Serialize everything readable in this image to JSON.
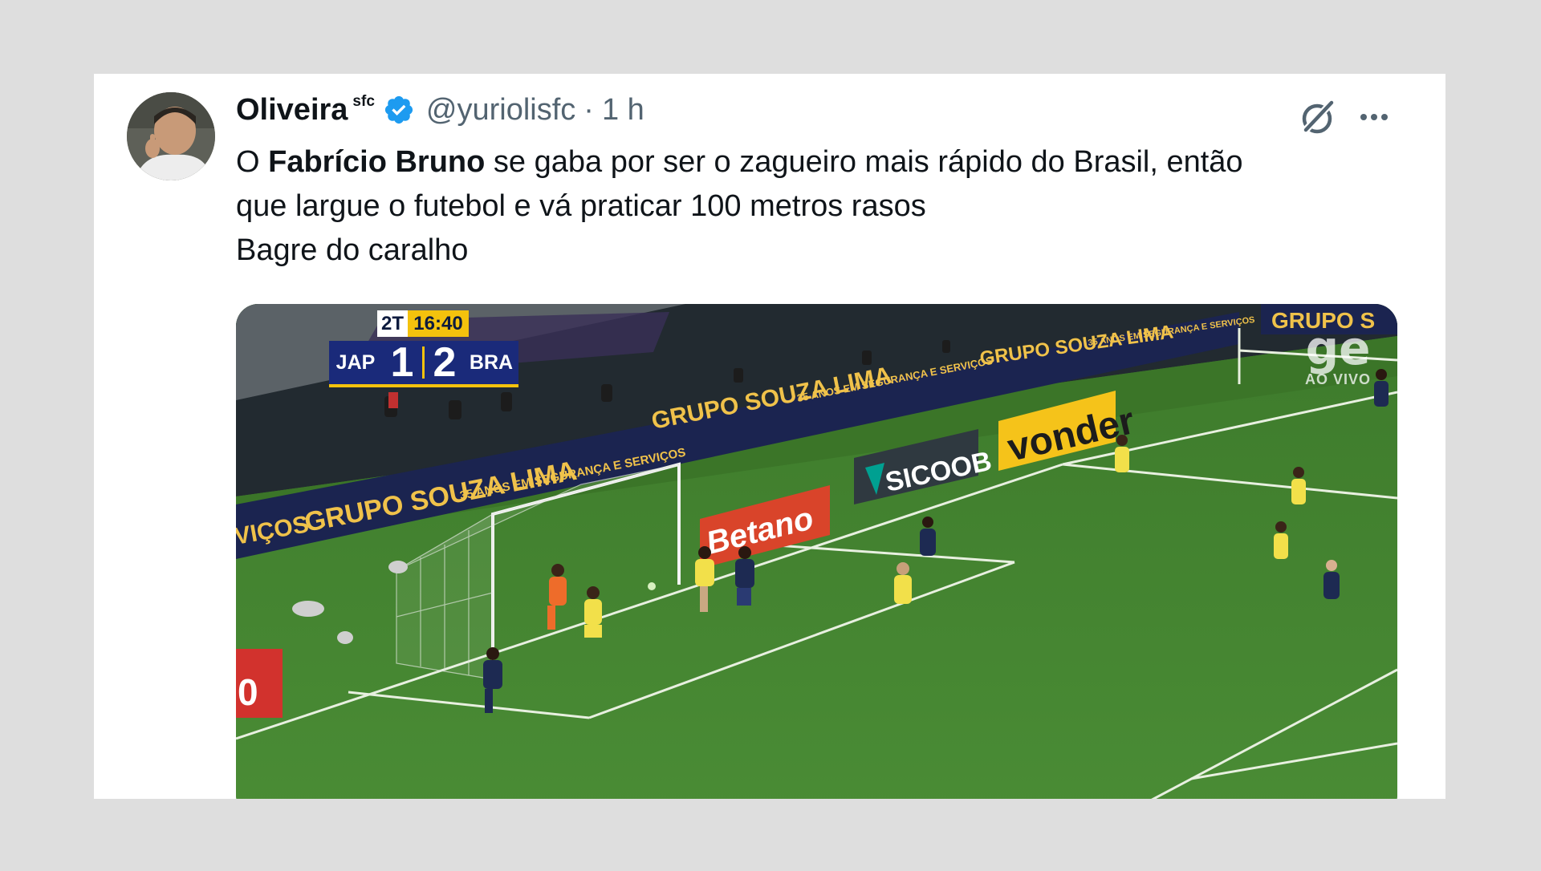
{
  "tweet": {
    "author_name": "Oliveira",
    "author_suffix": "sfc",
    "handle": "@yuriolisfc",
    "separator": "·",
    "time": "1 h",
    "text": {
      "line1_prefix": "O ",
      "line1_bold": "Fabrício Bruno",
      "line1_suffix": " se gaba por ser o zagueiro mais rápido do Brasil, então",
      "line2": "que largue o futebol e vá praticar 100 metros rasos",
      "line3": "Bagre do caralho"
    }
  },
  "media": {
    "scorebug": {
      "period": "2T",
      "clock": "16:40",
      "home_team": "JAP",
      "home_score": "1",
      "away_team": "BRA",
      "away_score": "2"
    },
    "broadcaster": {
      "logo": "ge",
      "live_label": "AO VIVO"
    },
    "boards": {
      "sponsor_main": "GRUPO SOUZA LIMA",
      "sponsor_tagline": "35 ANOS EM SEGURANÇA E SERVIÇOS",
      "sponsor_partial": "VIÇOS",
      "sponsor_topright": "GRUPO S",
      "board_betano": "Betano",
      "board_sicoob": "SICOOB",
      "board_vonder": "vonder",
      "board_left_fragment": "0"
    }
  },
  "icons": {
    "verified": "verified-badge-icon",
    "grok": "grok-icon",
    "more": "more-options-icon"
  },
  "colors": {
    "verified_blue": "#1d9bf0",
    "text_primary": "#0f1419",
    "text_secondary": "#536471",
    "brazil_yellow": "#f2e04a",
    "japan_navy": "#1d2a52"
  }
}
